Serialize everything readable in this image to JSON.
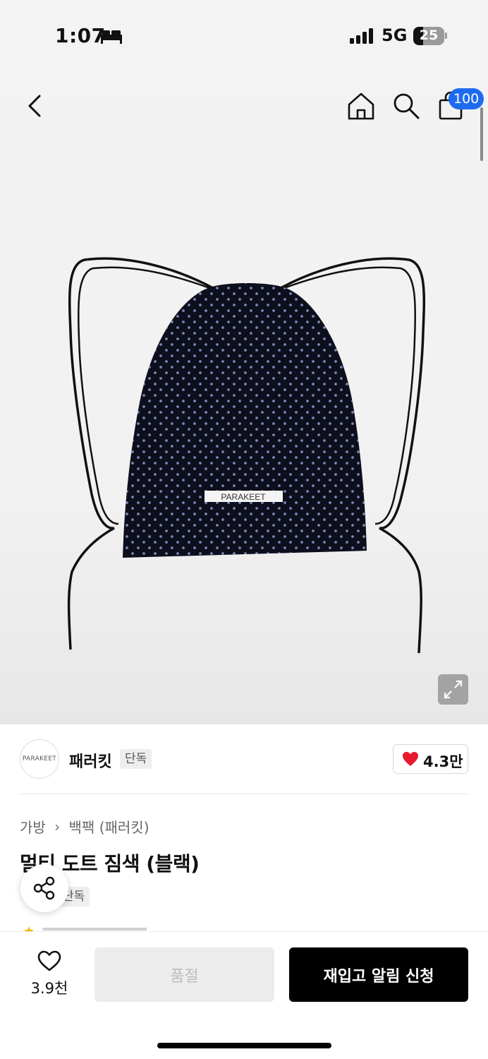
{
  "status_bar": {
    "time": "1:07",
    "network": "5G",
    "battery": "25"
  },
  "header": {
    "cart_count": "100"
  },
  "product_image": {
    "label_text": "PARAKEET"
  },
  "brand": {
    "logo_text": "PARAKEET",
    "name": "패러킷",
    "tag": "단독",
    "like_count": "4.3만"
  },
  "breadcrumb": {
    "category": "가방",
    "subcategory": "백팩 (패러킷)"
  },
  "product": {
    "title": "멀티 도트 짐색 (블랙)",
    "tag": "단독"
  },
  "bottom_bar": {
    "wish_count": "3.9천",
    "soldout_label": "품절",
    "restock_label": "재입고 알림 신청"
  },
  "colors": {
    "accent_blue": "#1f6bf0",
    "heart_red": "#e8192c",
    "primary_black": "#000000"
  }
}
